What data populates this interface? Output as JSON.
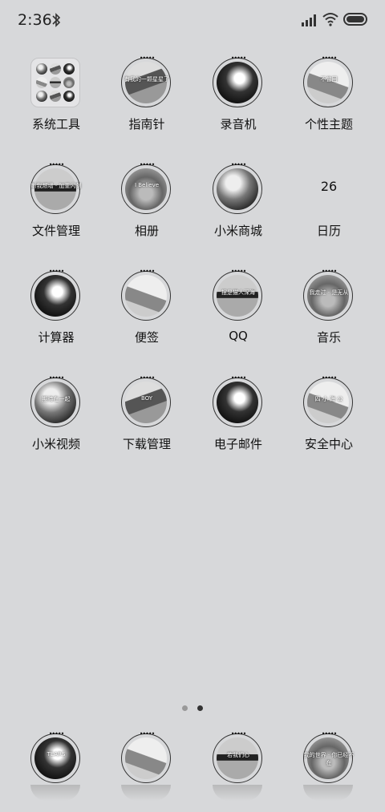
{
  "status_bar": {
    "time": "2:36"
  },
  "grid": [
    {
      "label": "系统工具",
      "icon": "folder-icon"
    },
    {
      "label": "指南针",
      "icon": "compass-icon",
      "overlay": "有我的一颗星星了"
    },
    {
      "label": "录音机",
      "icon": "recorder-icon"
    },
    {
      "label": "个性主题",
      "icon": "themes-icon",
      "overlay": "不曾回"
    },
    {
      "label": "文件管理",
      "icon": "file-manager-icon",
      "overlay": "断我燃墙 · 加重闪刻"
    },
    {
      "label": "相册",
      "icon": "gallery-icon",
      "overlay": "I Believe"
    },
    {
      "label": "小米商城",
      "icon": "mi-store-icon"
    },
    {
      "label": "日历",
      "icon": "calendar-icon",
      "day": "26"
    },
    {
      "label": "计算器",
      "icon": "calculator-icon"
    },
    {
      "label": "便签",
      "icon": "notes-icon"
    },
    {
      "label": "QQ",
      "icon": "qq-icon",
      "overlay": "摆是猫人深海"
    },
    {
      "label": "音乐",
      "icon": "music-icon",
      "overlay": "我走过 · 是无从"
    },
    {
      "label": "小米视频",
      "icon": "mi-video-icon",
      "overlay": "期待在一起"
    },
    {
      "label": "下载管理",
      "icon": "downloads-icon",
      "overlay": "BOY"
    },
    {
      "label": "电子邮件",
      "icon": "email-icon"
    },
    {
      "label": "安全中心",
      "icon": "security-icon",
      "overlay": "四 小 海 公"
    }
  ],
  "page_indicator": {
    "pages": 2,
    "active": 2
  },
  "dock": [
    {
      "icon": "phone-icon",
      "overlay": "TEARS"
    },
    {
      "icon": "contacts-icon"
    },
    {
      "icon": "messages-icon",
      "overlay": "若我们心"
    },
    {
      "icon": "browser-icon",
      "overlay": "我的世界 · 你已经不在"
    }
  ]
}
